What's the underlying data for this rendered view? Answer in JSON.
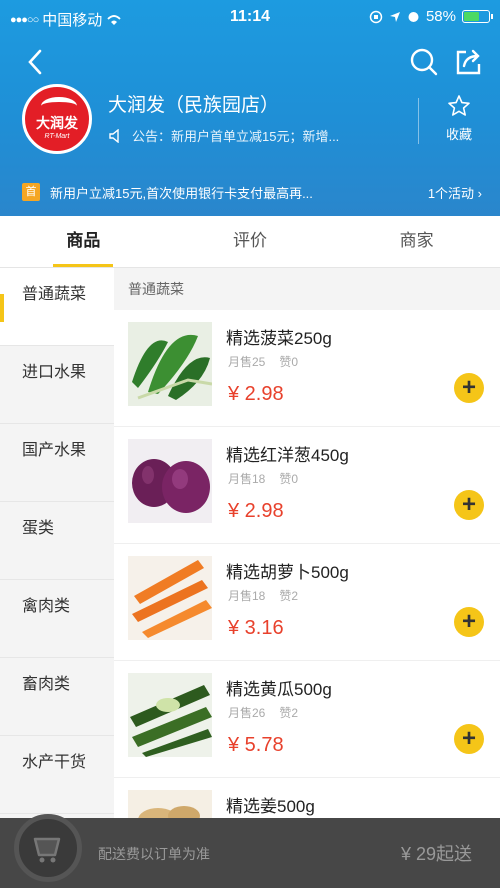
{
  "status_bar": {
    "carrier": "中国移动",
    "time": "11:14",
    "battery": "58%",
    "battery_level": 0.58
  },
  "store": {
    "name": "大润发（民族园店）",
    "logo_text": "大润发",
    "logo_sub": "RT-Mart",
    "notice": "公告：新用户首单立减15元；新增...",
    "favorite_label": "收藏"
  },
  "promo": {
    "badge": "首",
    "text": "新用户立减15元,首次使用银行卡支付最高再...",
    "more": "1个活动 ›"
  },
  "tabs": [
    {
      "label": "商品"
    },
    {
      "label": "评价"
    },
    {
      "label": "商家"
    }
  ],
  "categories": [
    {
      "label": "普通蔬菜"
    },
    {
      "label": "进口水果"
    },
    {
      "label": "国产水果"
    },
    {
      "label": "蛋类"
    },
    {
      "label": "禽肉类"
    },
    {
      "label": "畜肉类"
    },
    {
      "label": "水产干货"
    }
  ],
  "section_title": "普通蔬菜",
  "products": [
    {
      "name": "精选菠菜250g",
      "sales": "月售25",
      "likes": "赞0",
      "price": "¥ 2.98",
      "image": "spinach"
    },
    {
      "name": "精选红洋葱450g",
      "sales": "月售18",
      "likes": "赞0",
      "price": "¥ 2.98",
      "image": "red-onion"
    },
    {
      "name": "精选胡萝卜500g",
      "sales": "月售18",
      "likes": "赞2",
      "price": "¥ 3.16",
      "image": "carrot"
    },
    {
      "name": "精选黄瓜500g",
      "sales": "月售26",
      "likes": "赞2",
      "price": "¥ 5.78",
      "image": "cucumber"
    },
    {
      "name": "精选姜500g",
      "sales": "",
      "likes": "",
      "price": "",
      "image": "ginger"
    }
  ],
  "cart": {
    "delivery_note": "配送费以订单为准",
    "min_order": "¥ 29起送"
  },
  "colors": {
    "header": "#1f8fd6",
    "accent": "#f5c518",
    "price": "#e8412c"
  }
}
